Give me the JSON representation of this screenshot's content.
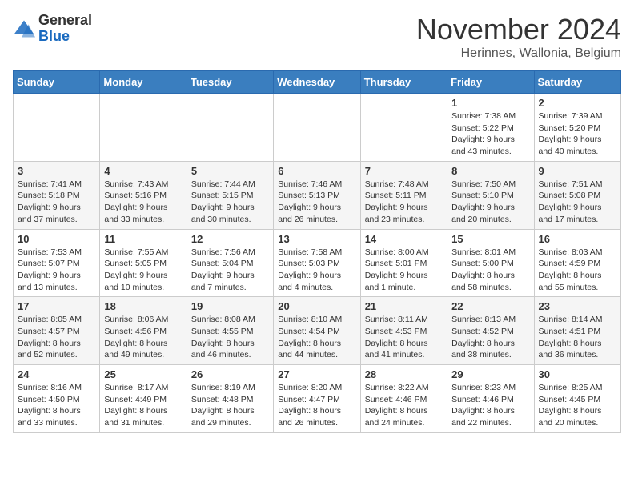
{
  "header": {
    "logo": {
      "general": "General",
      "blue": "Blue"
    },
    "month": "November 2024",
    "location": "Herinnes, Wallonia, Belgium"
  },
  "weekdays": [
    "Sunday",
    "Monday",
    "Tuesday",
    "Wednesday",
    "Thursday",
    "Friday",
    "Saturday"
  ],
  "weeks": [
    [
      {
        "day": "",
        "info": ""
      },
      {
        "day": "",
        "info": ""
      },
      {
        "day": "",
        "info": ""
      },
      {
        "day": "",
        "info": ""
      },
      {
        "day": "",
        "info": ""
      },
      {
        "day": "1",
        "info": "Sunrise: 7:38 AM\nSunset: 5:22 PM\nDaylight: 9 hours\nand 43 minutes."
      },
      {
        "day": "2",
        "info": "Sunrise: 7:39 AM\nSunset: 5:20 PM\nDaylight: 9 hours\nand 40 minutes."
      }
    ],
    [
      {
        "day": "3",
        "info": "Sunrise: 7:41 AM\nSunset: 5:18 PM\nDaylight: 9 hours\nand 37 minutes."
      },
      {
        "day": "4",
        "info": "Sunrise: 7:43 AM\nSunset: 5:16 PM\nDaylight: 9 hours\nand 33 minutes."
      },
      {
        "day": "5",
        "info": "Sunrise: 7:44 AM\nSunset: 5:15 PM\nDaylight: 9 hours\nand 30 minutes."
      },
      {
        "day": "6",
        "info": "Sunrise: 7:46 AM\nSunset: 5:13 PM\nDaylight: 9 hours\nand 26 minutes."
      },
      {
        "day": "7",
        "info": "Sunrise: 7:48 AM\nSunset: 5:11 PM\nDaylight: 9 hours\nand 23 minutes."
      },
      {
        "day": "8",
        "info": "Sunrise: 7:50 AM\nSunset: 5:10 PM\nDaylight: 9 hours\nand 20 minutes."
      },
      {
        "day": "9",
        "info": "Sunrise: 7:51 AM\nSunset: 5:08 PM\nDaylight: 9 hours\nand 17 minutes."
      }
    ],
    [
      {
        "day": "10",
        "info": "Sunrise: 7:53 AM\nSunset: 5:07 PM\nDaylight: 9 hours\nand 13 minutes."
      },
      {
        "day": "11",
        "info": "Sunrise: 7:55 AM\nSunset: 5:05 PM\nDaylight: 9 hours\nand 10 minutes."
      },
      {
        "day": "12",
        "info": "Sunrise: 7:56 AM\nSunset: 5:04 PM\nDaylight: 9 hours\nand 7 minutes."
      },
      {
        "day": "13",
        "info": "Sunrise: 7:58 AM\nSunset: 5:03 PM\nDaylight: 9 hours\nand 4 minutes."
      },
      {
        "day": "14",
        "info": "Sunrise: 8:00 AM\nSunset: 5:01 PM\nDaylight: 9 hours\nand 1 minute."
      },
      {
        "day": "15",
        "info": "Sunrise: 8:01 AM\nSunset: 5:00 PM\nDaylight: 8 hours\nand 58 minutes."
      },
      {
        "day": "16",
        "info": "Sunrise: 8:03 AM\nSunset: 4:59 PM\nDaylight: 8 hours\nand 55 minutes."
      }
    ],
    [
      {
        "day": "17",
        "info": "Sunrise: 8:05 AM\nSunset: 4:57 PM\nDaylight: 8 hours\nand 52 minutes."
      },
      {
        "day": "18",
        "info": "Sunrise: 8:06 AM\nSunset: 4:56 PM\nDaylight: 8 hours\nand 49 minutes."
      },
      {
        "day": "19",
        "info": "Sunrise: 8:08 AM\nSunset: 4:55 PM\nDaylight: 8 hours\nand 46 minutes."
      },
      {
        "day": "20",
        "info": "Sunrise: 8:10 AM\nSunset: 4:54 PM\nDaylight: 8 hours\nand 44 minutes."
      },
      {
        "day": "21",
        "info": "Sunrise: 8:11 AM\nSunset: 4:53 PM\nDaylight: 8 hours\nand 41 minutes."
      },
      {
        "day": "22",
        "info": "Sunrise: 8:13 AM\nSunset: 4:52 PM\nDaylight: 8 hours\nand 38 minutes."
      },
      {
        "day": "23",
        "info": "Sunrise: 8:14 AM\nSunset: 4:51 PM\nDaylight: 8 hours\nand 36 minutes."
      }
    ],
    [
      {
        "day": "24",
        "info": "Sunrise: 8:16 AM\nSunset: 4:50 PM\nDaylight: 8 hours\nand 33 minutes."
      },
      {
        "day": "25",
        "info": "Sunrise: 8:17 AM\nSunset: 4:49 PM\nDaylight: 8 hours\nand 31 minutes."
      },
      {
        "day": "26",
        "info": "Sunrise: 8:19 AM\nSunset: 4:48 PM\nDaylight: 8 hours\nand 29 minutes."
      },
      {
        "day": "27",
        "info": "Sunrise: 8:20 AM\nSunset: 4:47 PM\nDaylight: 8 hours\nand 26 minutes."
      },
      {
        "day": "28",
        "info": "Sunrise: 8:22 AM\nSunset: 4:46 PM\nDaylight: 8 hours\nand 24 minutes."
      },
      {
        "day": "29",
        "info": "Sunrise: 8:23 AM\nSunset: 4:46 PM\nDaylight: 8 hours\nand 22 minutes."
      },
      {
        "day": "30",
        "info": "Sunrise: 8:25 AM\nSunset: 4:45 PM\nDaylight: 8 hours\nand 20 minutes."
      }
    ]
  ]
}
